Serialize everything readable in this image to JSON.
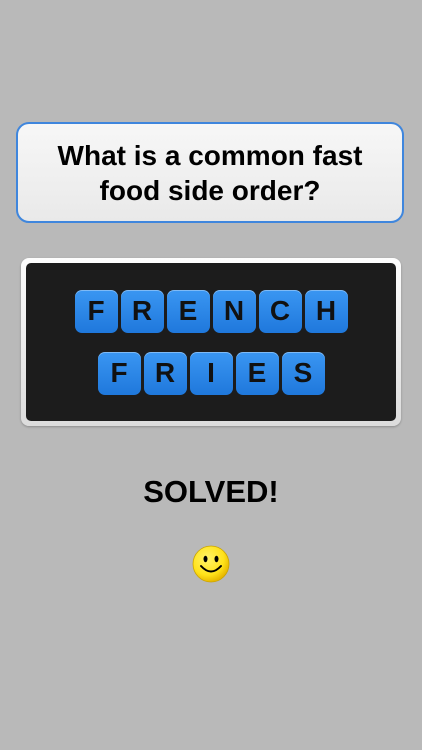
{
  "question": {
    "text": "What is a common fast food side order?"
  },
  "answer": {
    "words": [
      [
        "F",
        "R",
        "E",
        "N",
        "C",
        "H"
      ],
      [
        "F",
        "R",
        "I",
        "E",
        "S"
      ]
    ]
  },
  "status": {
    "text": "SOLVED!"
  },
  "icons": {
    "status_icon": "smiley-face-icon"
  },
  "colors": {
    "background": "#b9b9b9",
    "question_border": "#3f86dd",
    "board": "#1c1c1c",
    "tile": "#2a86e8",
    "smiley": "#ffe21a"
  }
}
